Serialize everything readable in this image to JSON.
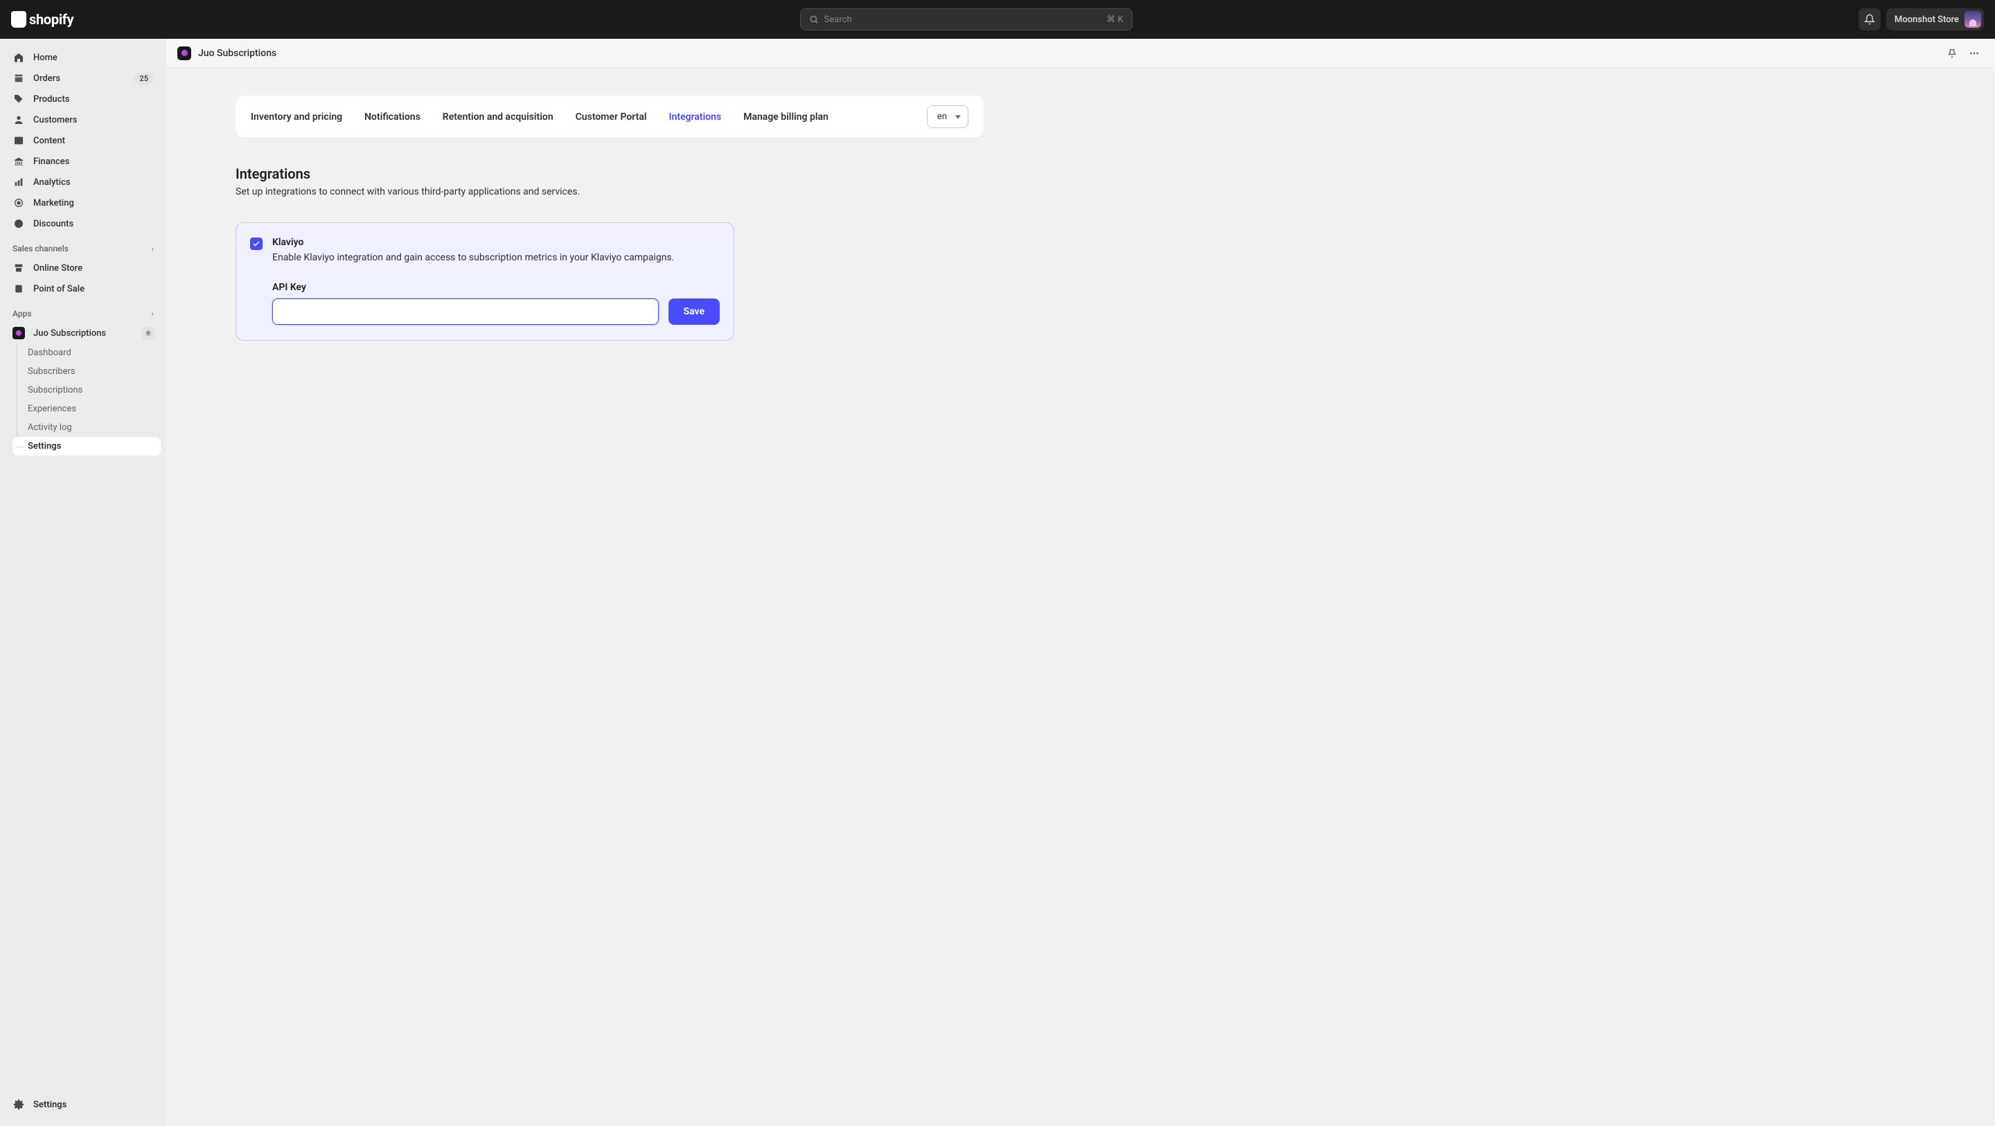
{
  "brand": {
    "name": "shopify"
  },
  "search": {
    "placeholder": "Search",
    "shortcut": "⌘ K"
  },
  "store": {
    "name": "Moonshot Store"
  },
  "sidebar": {
    "primary": [
      {
        "label": "Home",
        "icon": "home"
      },
      {
        "label": "Orders",
        "icon": "orders",
        "badge": "25"
      },
      {
        "label": "Products",
        "icon": "products"
      },
      {
        "label": "Customers",
        "icon": "customers"
      },
      {
        "label": "Content",
        "icon": "content"
      },
      {
        "label": "Finances",
        "icon": "finances"
      },
      {
        "label": "Analytics",
        "icon": "analytics"
      },
      {
        "label": "Marketing",
        "icon": "marketing"
      },
      {
        "label": "Discounts",
        "icon": "discounts"
      }
    ],
    "sections": {
      "sales_channels": "Sales channels",
      "apps": "Apps"
    },
    "channels": [
      {
        "label": "Online Store"
      },
      {
        "label": "Point of Sale"
      }
    ],
    "app": {
      "name": "Juo Subscriptions",
      "items": [
        {
          "label": "Dashboard"
        },
        {
          "label": "Subscribers"
        },
        {
          "label": "Subscriptions"
        },
        {
          "label": "Experiences"
        },
        {
          "label": "Activity log"
        },
        {
          "label": "Settings",
          "active": true
        }
      ]
    },
    "footer": {
      "settings": "Settings"
    }
  },
  "page": {
    "title": "Juo Subscriptions"
  },
  "tabs": [
    {
      "label": "Inventory and pricing"
    },
    {
      "label": "Notifications"
    },
    {
      "label": "Retention and acquisition"
    },
    {
      "label": "Customer Portal"
    },
    {
      "label": "Integrations",
      "active": true
    },
    {
      "label": "Manage billing plan"
    }
  ],
  "lang": {
    "value": "en"
  },
  "section": {
    "title": "Integrations",
    "desc": "Set up integrations to connect with various third-party applications and services."
  },
  "integration": {
    "name": "Klaviyo",
    "desc": "Enable Klaviyo integration and gain access to subscription metrics in your Klaviyo campaigns.",
    "enabled": true,
    "api_key_label": "API Key",
    "api_key_value": "",
    "save_label": "Save"
  }
}
